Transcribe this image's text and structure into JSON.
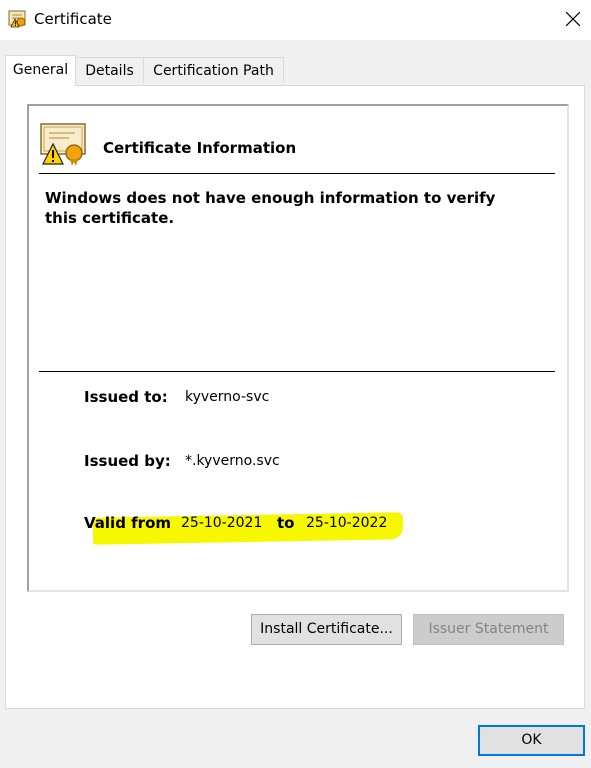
{
  "window": {
    "title": "Certificate",
    "icon": "certificate-icon"
  },
  "tabs": [
    {
      "label": "General",
      "active": true
    },
    {
      "label": "Details",
      "active": false
    },
    {
      "label": "Certification Path",
      "active": false
    }
  ],
  "info": {
    "heading": "Certificate Information",
    "warning": "Windows does not have enough information to verify this certificate.",
    "issued_to_label": "Issued to:",
    "issued_to_value": "kyverno-svc",
    "issued_by_label": "Issued by:",
    "issued_by_value": "*.kyverno.svc",
    "valid_from_label": "Valid from",
    "valid_from_value": "25-10-2021",
    "valid_to_label": "to",
    "valid_to_value": "25-10-2022",
    "highlight_color": "#f7f700"
  },
  "buttons": {
    "install": "Install Certificate...",
    "issuer_statement": "Issuer Statement",
    "ok": "OK"
  },
  "colors": {
    "accent": "#0078d7"
  }
}
